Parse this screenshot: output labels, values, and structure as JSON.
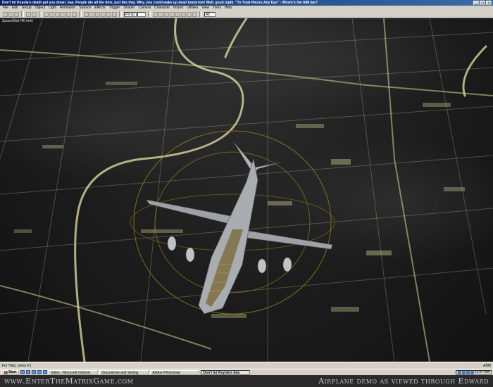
{
  "window": {
    "title": "Don't let Keyola's death get you down, baa. People die all the time, just like that. Why, you could wake up dead tomorrow! Well, good night. \"To Treat Pieces Any Eye\" - Where's the AIM bar?",
    "min": "_",
    "max": "□",
    "close": "×"
  },
  "menu": [
    "File",
    "Edit",
    "Group",
    "Object",
    "Light",
    "Animation",
    "Surface",
    "Effects",
    "Trigger",
    "Shader",
    "Camera",
    "Character",
    "Import",
    "Utilities",
    "View",
    "Tools",
    "Help"
  ],
  "toolbar": {
    "view_combo": "Persp",
    "select_combo": "All"
  },
  "viewport": {
    "label": "Space/Ball (40 mm)"
  },
  "status": {
    "left": "For Help, press F1",
    "right": "ABM"
  },
  "taskbar": {
    "start_label": "Start",
    "tasks": [
      {
        "label": "Inbox - Microsoft Outlook",
        "active": false
      },
      {
        "label": "Documents and Setting",
        "active": false
      },
      {
        "label": "Adobe Photoshop",
        "active": false
      },
      {
        "label": "Don't let Keyola's dea",
        "active": true
      }
    ],
    "clock": "11:57 AM"
  },
  "caption": {
    "left": "www.EnterTheMatrixGame.com",
    "right": "Airplane demo as viewed through Edward"
  },
  "colors": {
    "city_lights": "#d8d49a",
    "selection_ring": "#8a7a1a",
    "aircraft": "#a9acb0"
  }
}
